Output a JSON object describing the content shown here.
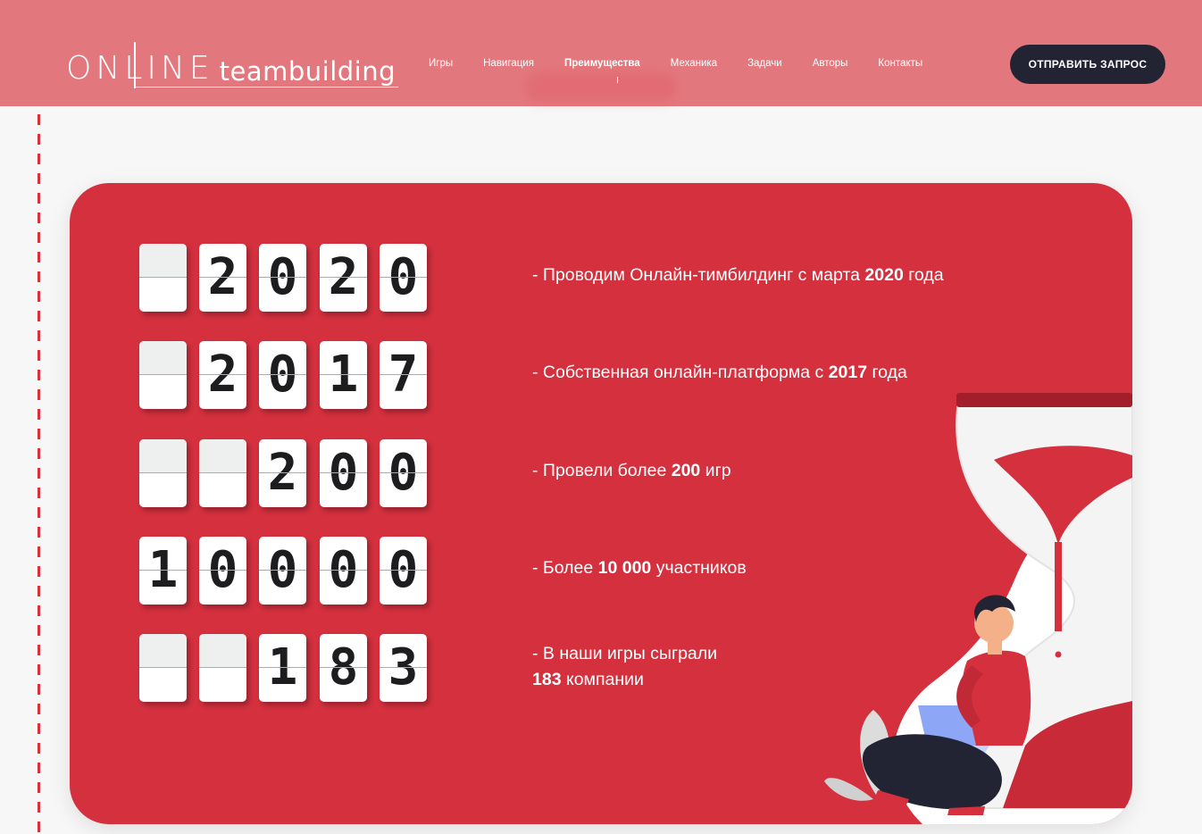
{
  "logo": {
    "main": "ONLINE",
    "sub": "teambuilding"
  },
  "nav": [
    {
      "label": "Игры",
      "active": false
    },
    {
      "label": "Навигация",
      "active": false
    },
    {
      "label": "Преимущества",
      "active": true
    },
    {
      "label": "Механика",
      "active": false
    },
    {
      "label": "Задачи",
      "active": false
    },
    {
      "label": "Авторы",
      "active": false
    },
    {
      "label": "Контакты",
      "active": false
    }
  ],
  "cta_label": "ОТПРАВИТЬ ЗАПРОС",
  "colors": {
    "header": "#e2787e",
    "card": "#d4303e",
    "cta": "#232433",
    "dash": "#d9323d"
  },
  "stats": [
    {
      "digits": [
        "",
        "2",
        "0",
        "2",
        "0"
      ],
      "prefix": "- Проводим Онлайн-тимбилдинг с марта ",
      "bold": "2020",
      "suffix": " года"
    },
    {
      "digits": [
        "",
        "2",
        "0",
        "1",
        "7"
      ],
      "prefix": "- Собственная онлайн-платформа с ",
      "bold": "2017",
      "suffix": " года"
    },
    {
      "digits": [
        "",
        "",
        "2",
        "0",
        "0"
      ],
      "prefix": "- Провели более ",
      "bold": "200",
      "suffix": " игр"
    },
    {
      "digits": [
        "1",
        "0",
        "0",
        "0",
        "0"
      ],
      "prefix": "- Более ",
      "bold": "10 000",
      "suffix": " участников"
    },
    {
      "digits": [
        "",
        "",
        "1",
        "8",
        "3"
      ],
      "prefix": "- В наши игры сыграли",
      "line2_bold": "183",
      "line2_suffix": " компании"
    }
  ],
  "illustration": {
    "icon": "hourglass-person-laptop-illustration"
  }
}
